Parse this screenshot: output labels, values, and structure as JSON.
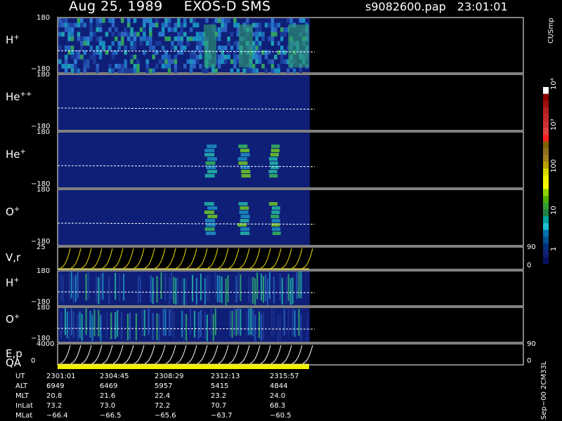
{
  "header": {
    "date": "Aug 25, 1989",
    "instrument": "EXOS-D SMS",
    "file": "s9082600.pap",
    "time": "23:01:01"
  },
  "panels": [
    {
      "species": "H",
      "charge": "+",
      "ymax": "180",
      "ymin": "−180",
      "style": "heavy"
    },
    {
      "species": "He",
      "charge": "++",
      "ymax": "180",
      "ymin": "−180",
      "style": "empty"
    },
    {
      "species": "He",
      "charge": "+",
      "ymax": "180",
      "ymin": "−180",
      "style": "sparse"
    },
    {
      "species": "O",
      "charge": "+",
      "ymax": "180",
      "ymin": "−180",
      "style": "sparse"
    },
    {
      "species": "V,r",
      "charge": "",
      "ymax": "25",
      "ymin": "",
      "right_top": "90",
      "right_bottom": "0",
      "style": "sweep"
    },
    {
      "species": "H",
      "charge": "+",
      "ymax": "180",
      "ymin": "−180",
      "style": "stripes"
    },
    {
      "species": "O",
      "charge": "+",
      "ymax": "180",
      "ymin": "−180",
      "style": "stripes"
    },
    {
      "species": "E,p",
      "charge": "",
      "ymax": "4000",
      "ymin": "0",
      "right_top": "90",
      "right_bottom": "0",
      "style": "sweep"
    }
  ],
  "qa_label": "QA",
  "colorbar": {
    "unit": "Ct/Smp",
    "labels": [
      "10⁴",
      "10³",
      "100",
      "10",
      "1"
    ],
    "colors": [
      "#ffffff",
      "#8b0000",
      "#a01010",
      "#b52020",
      "#c02828",
      "#d03030",
      "#e04040",
      "#ff2020",
      "#806000",
      "#907020",
      "#a08020",
      "#b8a000",
      "#d8d800",
      "#f0f000",
      "#f8f800",
      "#90d000",
      "#50b000",
      "#30a030",
      "#208040",
      "#00a0a0",
      "#20c0d0",
      "#0070b0",
      "#005090",
      "#003080",
      "#102070",
      "#0a1060"
    ]
  },
  "ephemeris": {
    "rows": [
      {
        "label": "UT",
        "values": [
          "2301:01",
          "2304:45",
          "2308:29",
          "2312:13",
          "2315:57"
        ]
      },
      {
        "label": "ALT",
        "values": [
          "6949",
          "6469",
          "5957",
          "5415",
          "4844"
        ]
      },
      {
        "label": "MLT",
        "values": [
          "20.8",
          "21.6",
          "22.4",
          "23.2",
          "24.0"
        ]
      },
      {
        "label": "InLat",
        "values": [
          "73.2",
          "73.0",
          "72.2",
          "70.7",
          "68.3"
        ]
      },
      {
        "label": "MLat",
        "values": [
          "−66.4",
          "−66.5",
          "−65.6",
          "−63.7",
          "−60.5"
        ]
      }
    ]
  },
  "footer_id": "Sep−00 2CM33L"
}
